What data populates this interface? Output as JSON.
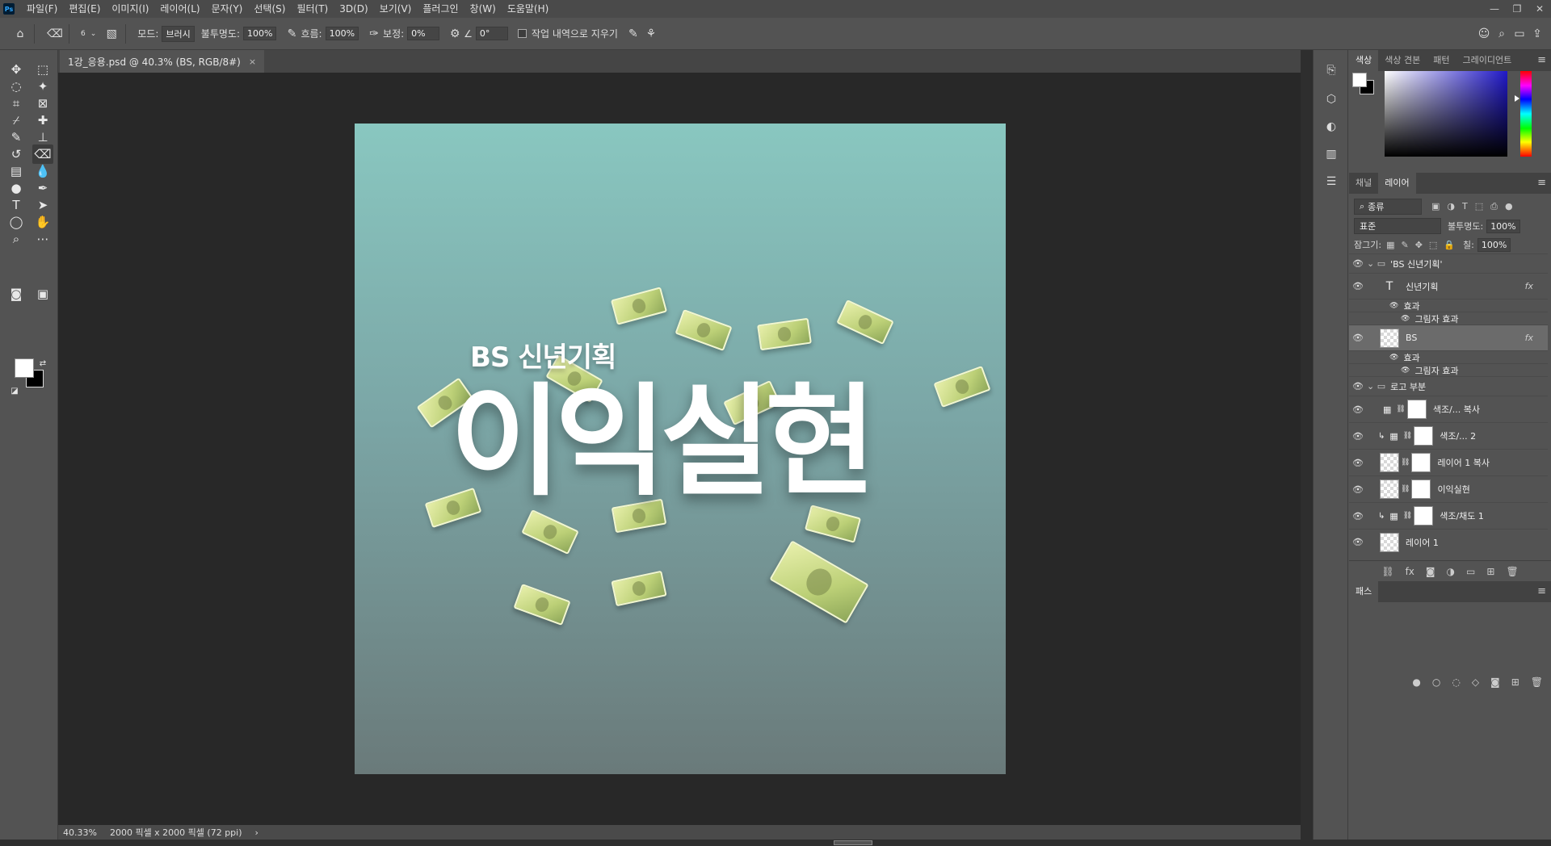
{
  "menubar": {
    "app_icon": "Ps",
    "items": [
      "파일(F)",
      "편집(E)",
      "이미지(I)",
      "레이어(L)",
      "문자(Y)",
      "선택(S)",
      "필터(T)",
      "3D(D)",
      "보기(V)",
      "플러그인",
      "창(W)",
      "도움말(H)"
    ]
  },
  "window_controls": {
    "minimize": "—",
    "restore": "❐",
    "close": "✕"
  },
  "options": {
    "brush_size": "6",
    "mode_label": "모드:",
    "mode_value": "브러시",
    "opacity_label": "불투명도:",
    "opacity_value": "100%",
    "flow_label": "흐름:",
    "flow_value": "100%",
    "smoothing_label": "보정:",
    "smoothing_value": "0%",
    "angle_value": "0°",
    "erase_history_label": "작업 내역으로 지우기"
  },
  "document": {
    "tab_title": "1강_응용.psd @ 40.3% (BS, RGB/8#)",
    "close": "×"
  },
  "artwork": {
    "subtitle": "BS 신년기획",
    "title": "이익실현"
  },
  "status": {
    "zoom": "40.33%",
    "info": "2000 픽셀 x 2000 픽셀 (72 ppi)",
    "arrow": "›"
  },
  "color_panel": {
    "tabs": [
      "색상",
      "색상 견본",
      "패턴",
      "그레이디언트"
    ],
    "active_tab": 0,
    "fg_color": "#ffffff",
    "bg_color": "#000000"
  },
  "layers_panel": {
    "tabs": [
      "채널",
      "레이어"
    ],
    "active_tab": 1,
    "filter_kind": "종류",
    "blend_mode": "표준",
    "opacity_label": "불투명도:",
    "opacity_value": "100%",
    "lock_label": "잠그기:",
    "fill_label": "칠:",
    "fill_value": "100%",
    "layers": [
      {
        "name": "'BS 신년기획'",
        "kind": "group",
        "indent": 0,
        "visible": true
      },
      {
        "name": "신년기획",
        "kind": "text",
        "indent": 1,
        "visible": true,
        "fx": "fx"
      },
      {
        "name": "효과",
        "kind": "effect",
        "indent": 2,
        "visible": true
      },
      {
        "name": "그림자 효과",
        "kind": "effect",
        "indent": 3,
        "visible": true
      },
      {
        "name": "BS",
        "kind": "pixel",
        "indent": 1,
        "visible": true,
        "fx": "fx",
        "selected": true
      },
      {
        "name": "효과",
        "kind": "effect",
        "indent": 2,
        "visible": true
      },
      {
        "name": "그림자 효과",
        "kind": "effect",
        "indent": 3,
        "visible": true
      },
      {
        "name": "로고 부분",
        "kind": "group",
        "indent": 0,
        "visible": true
      },
      {
        "name": "색조/... 복사",
        "kind": "adjust",
        "indent": 1,
        "visible": true
      },
      {
        "name": "색조/... 2",
        "kind": "adjust-clip",
        "indent": 1,
        "visible": true
      },
      {
        "name": "레이어 1 복사",
        "kind": "pixel-mask",
        "indent": 1,
        "visible": true
      },
      {
        "name": "이익실현",
        "kind": "pixel-mask",
        "indent": 1,
        "visible": true
      },
      {
        "name": "색조/채도 1",
        "kind": "adjust-clip",
        "indent": 1,
        "visible": true
      },
      {
        "name": "레이어 1",
        "kind": "pixel",
        "indent": 1,
        "visible": true
      }
    ]
  },
  "paths_panel": {
    "tabs": [
      "패스"
    ]
  }
}
